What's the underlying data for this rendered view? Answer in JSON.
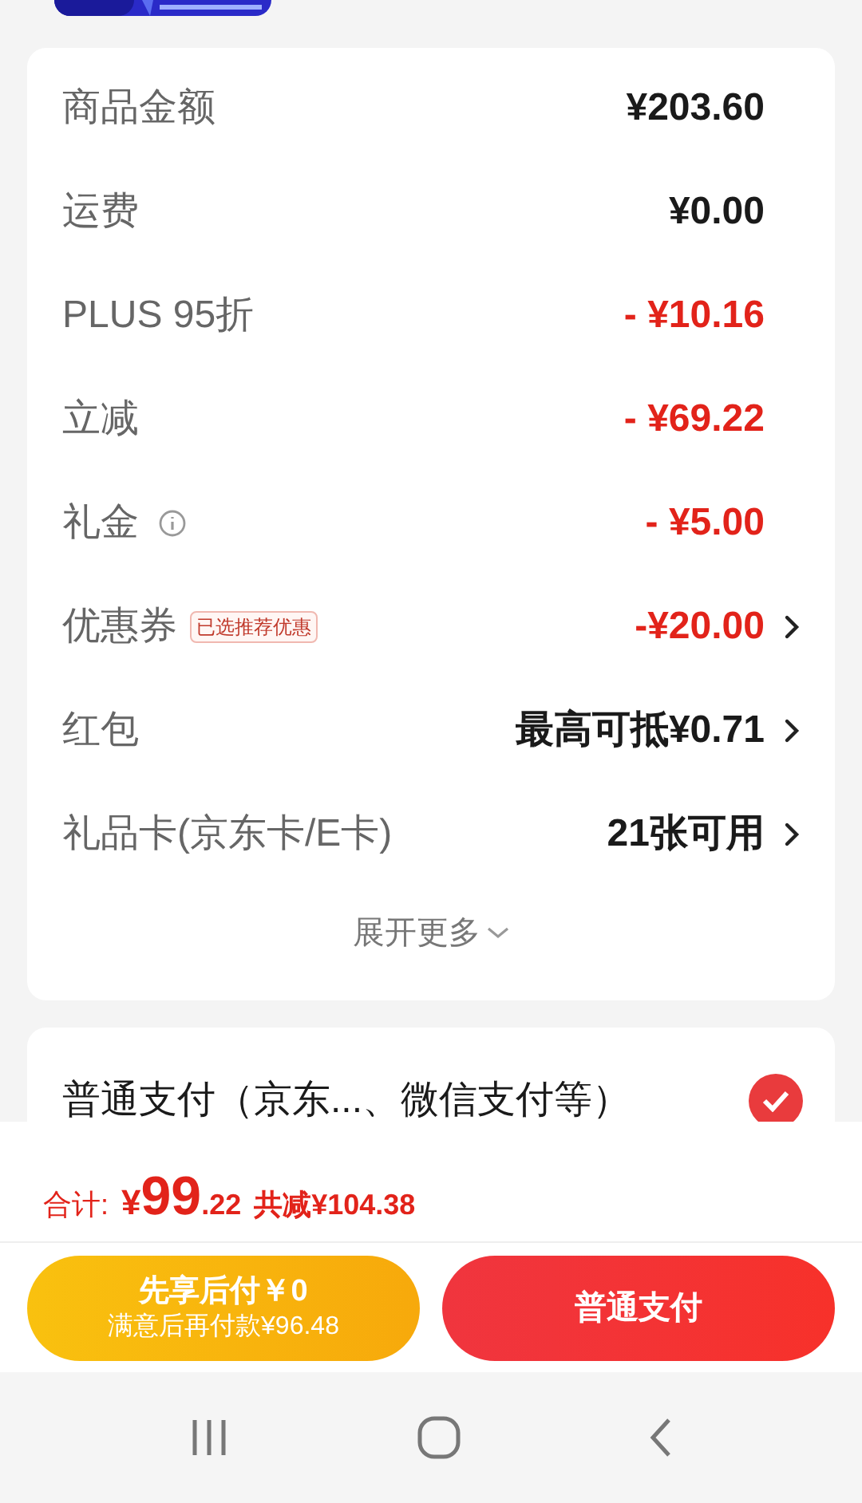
{
  "summary_rows": [
    {
      "label": "商品金额",
      "value": "¥203.60",
      "kind": "amount",
      "chevron": false,
      "info": false
    },
    {
      "label": "运费",
      "value": "¥0.00",
      "kind": "amount",
      "chevron": false,
      "info": false
    },
    {
      "label": "PLUS 95折",
      "value": "- ¥10.16",
      "kind": "discount",
      "chevron": false,
      "info": false
    },
    {
      "label": "立减",
      "value": "- ¥69.22",
      "kind": "discount",
      "chevron": false,
      "info": false
    },
    {
      "label": "礼金",
      "value": "- ¥5.00",
      "kind": "discount",
      "chevron": false,
      "info": true
    },
    {
      "label": "优惠券",
      "tag": "已选推荐优惠",
      "value": "-¥20.00",
      "kind": "discount",
      "chevron": true,
      "info": false
    },
    {
      "label": "红包",
      "value": "最高可抵¥0.71",
      "kind": "amount",
      "chevron": true,
      "info": false
    },
    {
      "label": "礼品卡(京东卡/E卡)",
      "value": "21张可用",
      "kind": "amount",
      "chevron": true,
      "info": false
    }
  ],
  "expand_more": "展开更多",
  "payment_options": [
    {
      "label": "普通支付（京东...、微信支付等）",
      "selected": true
    }
  ],
  "total": {
    "label": "合计:",
    "currency": "¥",
    "integer": "99",
    "decimal": ".22",
    "savings": "共减¥104.38"
  },
  "buttons": [
    {
      "kind": "pay_later",
      "title": "先享后付￥0",
      "subtitle": "满意后再付款¥96.48"
    },
    {
      "kind": "pay",
      "title": "普通支付"
    }
  ]
}
